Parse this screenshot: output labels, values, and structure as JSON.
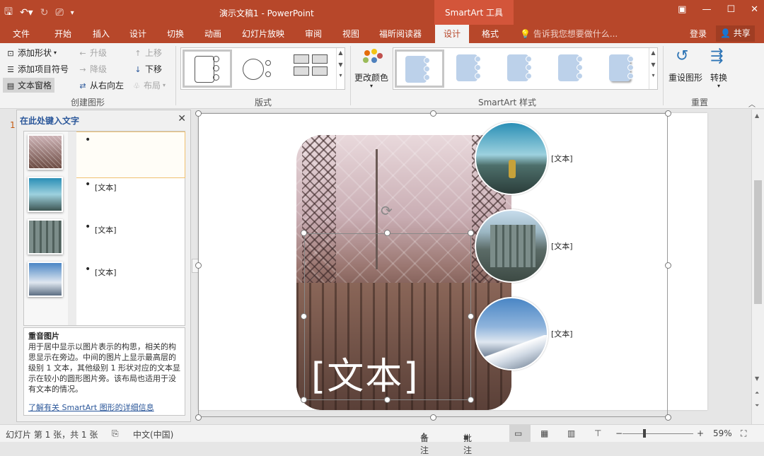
{
  "titlebar": {
    "doc_title": "演示文稿1 - PowerPoint",
    "context_title": "SmartArt 工具"
  },
  "tabs": [
    "文件",
    "开始",
    "插入",
    "设计",
    "切换",
    "动画",
    "幻灯片放映",
    "审阅",
    "视图",
    "福昕阅读器",
    "设计",
    "格式"
  ],
  "tellme": "告诉我您想要做什么...",
  "login": "登录",
  "share": "共享",
  "ribbon": {
    "create": {
      "add_shape": "添加形状",
      "add_bullet": "添加项目符号",
      "text_pane": "文本窗格",
      "promote": "升级",
      "demote": "降级",
      "rtl": "从右向左",
      "move_up": "上移",
      "move_down": "下移",
      "layout": "布局",
      "label": "创建图形"
    },
    "layouts_label": "版式",
    "change_colors": "更改颜色",
    "styles_label": "SmartArt 样式",
    "reset_graphic": "重设图形",
    "convert": "转换",
    "reset_label": "重置"
  },
  "text_pane": {
    "title": "在此处键入文字",
    "items": [
      "",
      "[文本]",
      "[文本]",
      "[文本]"
    ],
    "desc_title": "重音图片",
    "desc_body": "用于居中显示以图片表示的构思，相关的构思显示在旁边。中间的图片上显示最高层的级别 1 文本，其他级别 1 形状对应的文本显示在较小的圆形图片旁。该布局也适用于没有文本的情况。",
    "desc_link": "了解有关 SmartArt 图形的详细信息"
  },
  "slide": {
    "number": "1",
    "big_text": "[文本]",
    "circle_texts": [
      "[文本]",
      "[文本]",
      "[文本]"
    ]
  },
  "status": {
    "slide_info": "幻灯片 第 1 张，共 1 张",
    "language": "中文(中国)",
    "notes": "备注",
    "comments": "批注",
    "zoom": "59%"
  },
  "colors": {
    "accent": "#b7472a",
    "context_tab": "#d3553a"
  }
}
